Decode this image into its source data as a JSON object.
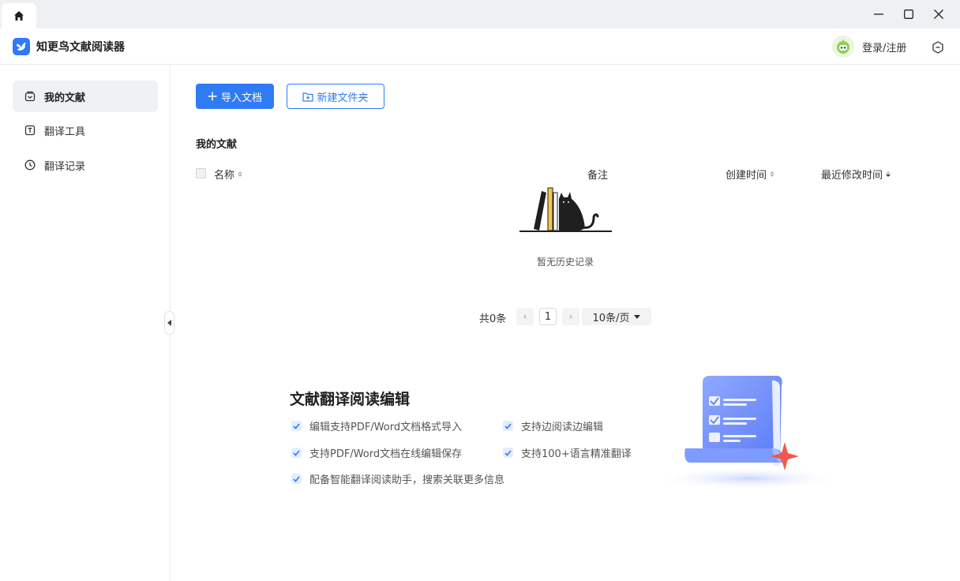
{
  "window": {
    "home_tab_icon": "home-icon",
    "controls": [
      "minimize-icon",
      "maximize-icon",
      "close-icon"
    ]
  },
  "header": {
    "app_name": "知更鸟文献阅读器",
    "login_label": "登录/注册",
    "brand_color": "#2f7bf5"
  },
  "sidebar": {
    "items": [
      {
        "label": "我的文献",
        "icon": "library-icon",
        "active": true
      },
      {
        "label": "翻译工具",
        "icon": "translate-icon",
        "active": false
      },
      {
        "label": "翻译记录",
        "icon": "clock-icon",
        "active": false
      }
    ]
  },
  "toolbar": {
    "import_label": "导入文档",
    "new_folder_label": "新建文件夹"
  },
  "main": {
    "section_title": "我的文献",
    "columns": {
      "name": "名称",
      "note": "备注",
      "created": "创建时间",
      "modified": "最近修改时间"
    },
    "empty_text": "暂无历史记录"
  },
  "pager": {
    "total": "共0条",
    "prev": "‹",
    "page": "1",
    "next": "›",
    "page_size": "10条/页"
  },
  "promo": {
    "title": "文献翻译阅读编辑",
    "features": [
      "编辑支持PDF/Word文档格式导入",
      "支持边阅读边编辑",
      "支持PDF/Word文档在线编辑保存",
      "支持100+语言精准翻译",
      "配备智能翻译阅读助手，搜索关联更多信息"
    ]
  }
}
